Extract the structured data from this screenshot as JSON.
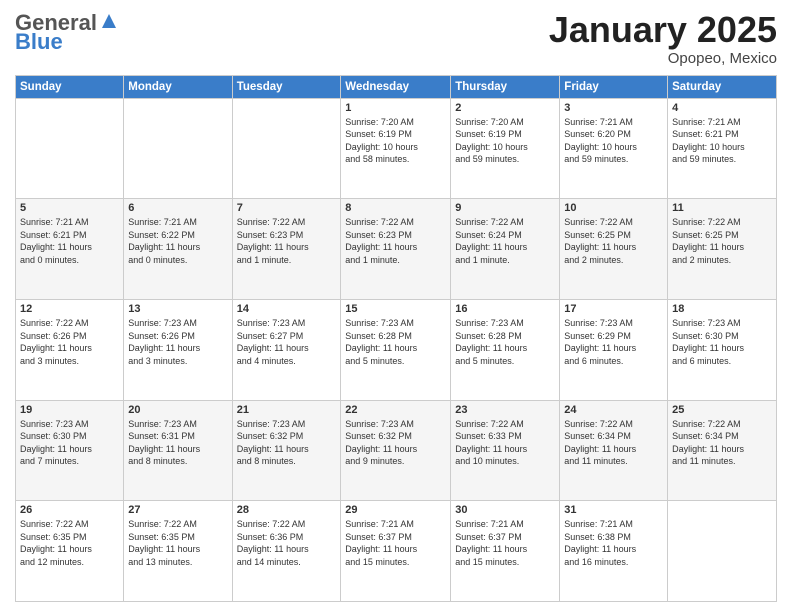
{
  "header": {
    "logo_general": "General",
    "logo_blue": "Blue",
    "month": "January 2025",
    "location": "Opopeo, Mexico"
  },
  "days_of_week": [
    "Sunday",
    "Monday",
    "Tuesday",
    "Wednesday",
    "Thursday",
    "Friday",
    "Saturday"
  ],
  "weeks": [
    [
      {
        "num": "",
        "info": ""
      },
      {
        "num": "",
        "info": ""
      },
      {
        "num": "",
        "info": ""
      },
      {
        "num": "1",
        "info": "Sunrise: 7:20 AM\nSunset: 6:19 PM\nDaylight: 10 hours\nand 58 minutes."
      },
      {
        "num": "2",
        "info": "Sunrise: 7:20 AM\nSunset: 6:19 PM\nDaylight: 10 hours\nand 59 minutes."
      },
      {
        "num": "3",
        "info": "Sunrise: 7:21 AM\nSunset: 6:20 PM\nDaylight: 10 hours\nand 59 minutes."
      },
      {
        "num": "4",
        "info": "Sunrise: 7:21 AM\nSunset: 6:21 PM\nDaylight: 10 hours\nand 59 minutes."
      }
    ],
    [
      {
        "num": "5",
        "info": "Sunrise: 7:21 AM\nSunset: 6:21 PM\nDaylight: 11 hours\nand 0 minutes."
      },
      {
        "num": "6",
        "info": "Sunrise: 7:21 AM\nSunset: 6:22 PM\nDaylight: 11 hours\nand 0 minutes."
      },
      {
        "num": "7",
        "info": "Sunrise: 7:22 AM\nSunset: 6:23 PM\nDaylight: 11 hours\nand 1 minute."
      },
      {
        "num": "8",
        "info": "Sunrise: 7:22 AM\nSunset: 6:23 PM\nDaylight: 11 hours\nand 1 minute."
      },
      {
        "num": "9",
        "info": "Sunrise: 7:22 AM\nSunset: 6:24 PM\nDaylight: 11 hours\nand 1 minute."
      },
      {
        "num": "10",
        "info": "Sunrise: 7:22 AM\nSunset: 6:25 PM\nDaylight: 11 hours\nand 2 minutes."
      },
      {
        "num": "11",
        "info": "Sunrise: 7:22 AM\nSunset: 6:25 PM\nDaylight: 11 hours\nand 2 minutes."
      }
    ],
    [
      {
        "num": "12",
        "info": "Sunrise: 7:22 AM\nSunset: 6:26 PM\nDaylight: 11 hours\nand 3 minutes."
      },
      {
        "num": "13",
        "info": "Sunrise: 7:23 AM\nSunset: 6:26 PM\nDaylight: 11 hours\nand 3 minutes."
      },
      {
        "num": "14",
        "info": "Sunrise: 7:23 AM\nSunset: 6:27 PM\nDaylight: 11 hours\nand 4 minutes."
      },
      {
        "num": "15",
        "info": "Sunrise: 7:23 AM\nSunset: 6:28 PM\nDaylight: 11 hours\nand 5 minutes."
      },
      {
        "num": "16",
        "info": "Sunrise: 7:23 AM\nSunset: 6:28 PM\nDaylight: 11 hours\nand 5 minutes."
      },
      {
        "num": "17",
        "info": "Sunrise: 7:23 AM\nSunset: 6:29 PM\nDaylight: 11 hours\nand 6 minutes."
      },
      {
        "num": "18",
        "info": "Sunrise: 7:23 AM\nSunset: 6:30 PM\nDaylight: 11 hours\nand 6 minutes."
      }
    ],
    [
      {
        "num": "19",
        "info": "Sunrise: 7:23 AM\nSunset: 6:30 PM\nDaylight: 11 hours\nand 7 minutes."
      },
      {
        "num": "20",
        "info": "Sunrise: 7:23 AM\nSunset: 6:31 PM\nDaylight: 11 hours\nand 8 minutes."
      },
      {
        "num": "21",
        "info": "Sunrise: 7:23 AM\nSunset: 6:32 PM\nDaylight: 11 hours\nand 8 minutes."
      },
      {
        "num": "22",
        "info": "Sunrise: 7:23 AM\nSunset: 6:32 PM\nDaylight: 11 hours\nand 9 minutes."
      },
      {
        "num": "23",
        "info": "Sunrise: 7:22 AM\nSunset: 6:33 PM\nDaylight: 11 hours\nand 10 minutes."
      },
      {
        "num": "24",
        "info": "Sunrise: 7:22 AM\nSunset: 6:34 PM\nDaylight: 11 hours\nand 11 minutes."
      },
      {
        "num": "25",
        "info": "Sunrise: 7:22 AM\nSunset: 6:34 PM\nDaylight: 11 hours\nand 11 minutes."
      }
    ],
    [
      {
        "num": "26",
        "info": "Sunrise: 7:22 AM\nSunset: 6:35 PM\nDaylight: 11 hours\nand 12 minutes."
      },
      {
        "num": "27",
        "info": "Sunrise: 7:22 AM\nSunset: 6:35 PM\nDaylight: 11 hours\nand 13 minutes."
      },
      {
        "num": "28",
        "info": "Sunrise: 7:22 AM\nSunset: 6:36 PM\nDaylight: 11 hours\nand 14 minutes."
      },
      {
        "num": "29",
        "info": "Sunrise: 7:21 AM\nSunset: 6:37 PM\nDaylight: 11 hours\nand 15 minutes."
      },
      {
        "num": "30",
        "info": "Sunrise: 7:21 AM\nSunset: 6:37 PM\nDaylight: 11 hours\nand 15 minutes."
      },
      {
        "num": "31",
        "info": "Sunrise: 7:21 AM\nSunset: 6:38 PM\nDaylight: 11 hours\nand 16 minutes."
      },
      {
        "num": "",
        "info": ""
      }
    ]
  ]
}
